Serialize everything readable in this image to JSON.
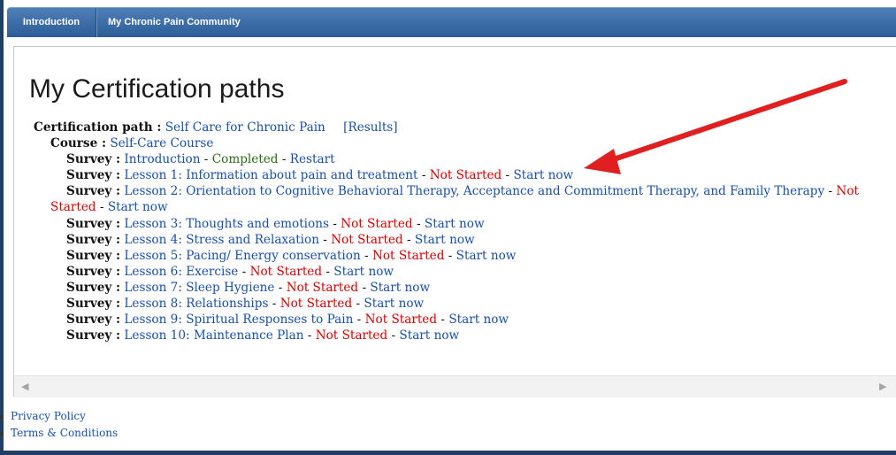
{
  "nav": {
    "tabs": [
      "Introduction",
      "My Chronic Pain Community"
    ]
  },
  "page": {
    "title": "My Certification paths"
  },
  "certification": {
    "label": "Certification path :",
    "name": "Self Care for Chronic Pain",
    "results": "[Results]"
  },
  "course": {
    "label": "Course :",
    "name": "Self-Care Course"
  },
  "survey_label": "Survey :",
  "separator": " - ",
  "surveys": [
    {
      "name": "Introduction",
      "status": "Completed",
      "action": "Restart"
    },
    {
      "name": "Lesson 1: Information about pain and treatment",
      "status": "Not Started",
      "action": "Start now"
    },
    {
      "name": "Lesson 2: Orientation to Cognitive Behavioral Therapy, Acceptance and Commitment Therapy, and Family Therapy",
      "status_part1": "Not",
      "status_part2": "Started",
      "action": "Start now"
    },
    {
      "name": "Lesson 3: Thoughts and emotions",
      "status": "Not Started",
      "action": "Start now"
    },
    {
      "name": "Lesson 4: Stress and Relaxation",
      "status": "Not Started",
      "action": "Start now"
    },
    {
      "name": "Lesson 5: Pacing/ Energy conservation",
      "status": "Not Started",
      "action": "Start now"
    },
    {
      "name": "Lesson 6: Exercise",
      "status": "Not Started",
      "action": "Start now"
    },
    {
      "name": "Lesson 7: Sleep Hygiene",
      "status": "Not Started",
      "action": "Start now"
    },
    {
      "name": "Lesson 8: Relationships",
      "status": "Not Started",
      "action": "Start now"
    },
    {
      "name": "Lesson 9: Spiritual Responses to Pain",
      "status": "Not Started",
      "action": "Start now"
    },
    {
      "name": "Lesson 10: Maintenance Plan",
      "status": "Not Started",
      "action": "Start now"
    }
  ],
  "scrollbar": {
    "left_icon": "◀",
    "right_icon": "▶"
  },
  "footer": {
    "links": [
      "Privacy Policy",
      "Terms & Conditions"
    ]
  },
  "annotation": {
    "arrow_color": "#e02020"
  }
}
